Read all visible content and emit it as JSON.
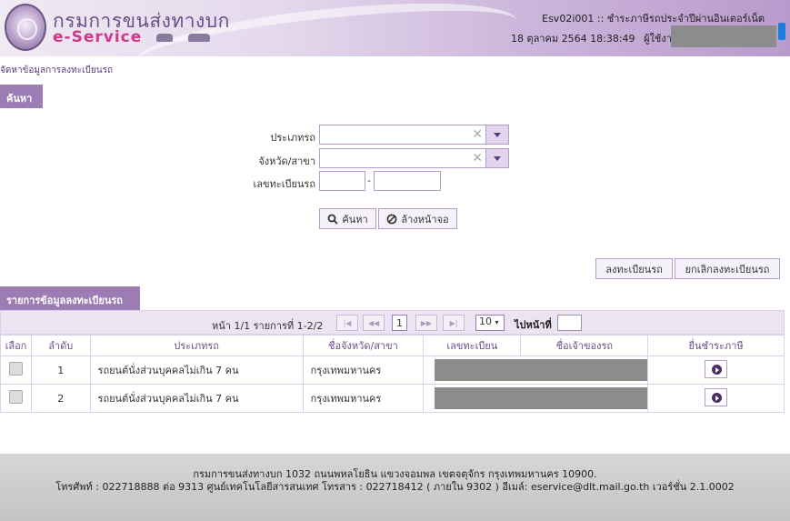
{
  "header": {
    "brand_thai": "กรมการขนส่งทางบก",
    "brand_en_e": "e",
    "brand_en_rest": "-Service",
    "program_title": "Esv02i001 :: ชำระภาษีรถประจำปีผ่านอินเตอร์เน็ต",
    "datetime": "18 ตุลาคม 2564 18:38:49",
    "user_label": "ผู้ใช้งาน"
  },
  "breadcrumb": "จัดหาข้อมูลการลงทะเบียนรถ",
  "search": {
    "section_title": "ค้นหา",
    "vehicle_type_label": "ประเภทรถ",
    "province_label": "จังหวัด/สาขา",
    "plate_label": "เลขทะเบียนรถ",
    "plate_separator": "-",
    "clear_glyph": "✕",
    "search_button": "ค้นหา",
    "clear_button": "ล้างหน้าจอ"
  },
  "actions": {
    "register_button": "ลงทะเบียนรถ",
    "cancel_register_button": "ยกเลิกลงทะเบียนรถ"
  },
  "results": {
    "section_title": "รายการข้อมูลลงทะเบียนรถ",
    "pager_text": "หน้า 1/1 รายการที่ 1-2/2",
    "first": "|◀",
    "prev": "◀◀",
    "current_page": "1",
    "next": "▶▶",
    "last": "▶|",
    "page_size": "10",
    "goto_label": "ไปหน้าที่",
    "columns": [
      "เลือก",
      "ลำดับ",
      "ประเภทรถ",
      "ชื่อจังหวัด/สาขา",
      "เลขทะเบียน",
      "ชื่อเจ้าของรถ",
      "ยื่นชำระภาษี"
    ],
    "rows": [
      {
        "index": "1",
        "type": "รถยนต์นั่งส่วนบุคคลไม่เกิน 7 คน",
        "province": "กรุงเทพมหานคร"
      },
      {
        "index": "2",
        "type": "รถยนต์นั่งส่วนบุคคลไม่เกิน 7 คน",
        "province": "กรุงเทพมหานคร"
      }
    ]
  },
  "footer": {
    "line1": "กรมการขนส่งทางบก 1032 ถนนพหลโยธิน แขวงจอมพล เขตจตุจักร กรุงเทพมหานคร 10900.",
    "line2": "โทรศัพท์ : 022718888 ต่อ 9313 ศูนย์เทคโนโลยีสารสนเทศ โทรสาร : 022718412 ( ภายใน 9302 ) อีเมล์: eservice@dlt.mail.go.th เวอร์ชั่น 2.1.0002"
  }
}
